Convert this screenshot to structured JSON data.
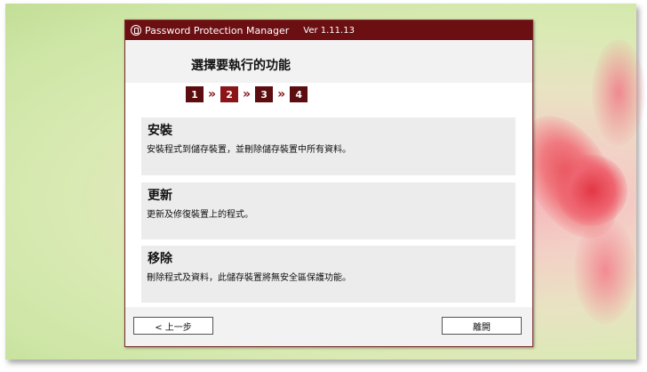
{
  "window": {
    "app_title": "Password Protection Manager",
    "version": "Ver 1.11.13"
  },
  "header": {
    "title": "選擇要執行的功能"
  },
  "steps": [
    "1",
    "2",
    "3",
    "4"
  ],
  "step_separator": "»",
  "options": [
    {
      "title": "安裝",
      "description": "安裝程式到儲存裝置，並刪除儲存裝置中所有資料。"
    },
    {
      "title": "更新",
      "description": "更新及修復裝置上的程式。"
    },
    {
      "title": "移除",
      "description": "刪除程式及資料，此儲存裝置將無安全區保護功能。"
    }
  ],
  "footer": {
    "back_label": "< 上一步",
    "close_label": "離開"
  },
  "colors": {
    "titlebar": "#6b0f12",
    "step": "#5c0d10",
    "active_step": "#8a1418"
  }
}
